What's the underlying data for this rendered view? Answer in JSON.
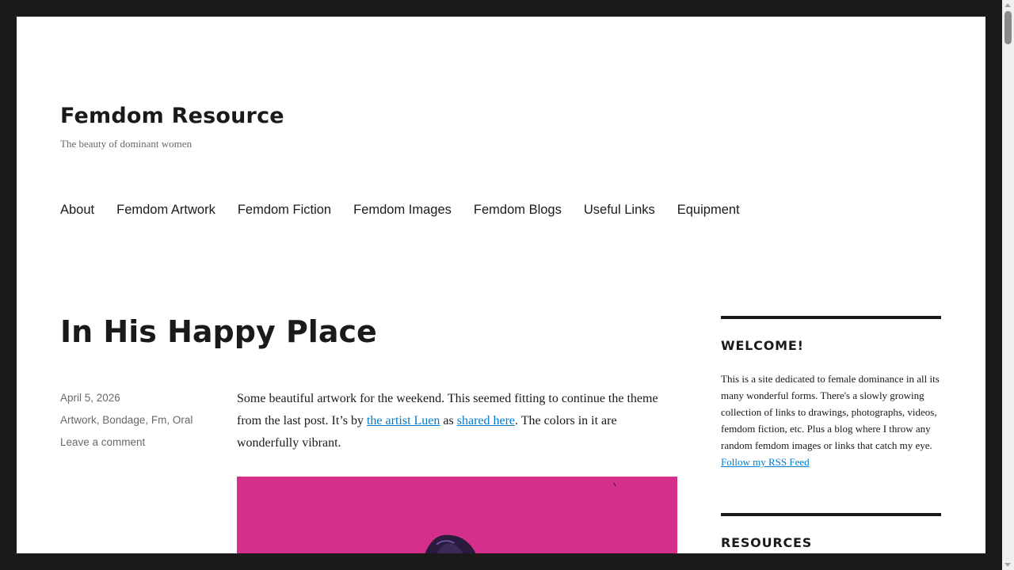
{
  "site": {
    "title": "Femdom Resource",
    "tagline": "The beauty of dominant women"
  },
  "nav": {
    "items": [
      {
        "label": "About"
      },
      {
        "label": "Femdom Artwork"
      },
      {
        "label": "Femdom Fiction"
      },
      {
        "label": "Femdom Images"
      },
      {
        "label": "Femdom Blogs"
      },
      {
        "label": "Useful Links"
      },
      {
        "label": "Equipment"
      }
    ]
  },
  "post": {
    "title": "In His Happy Place",
    "date": "April 5, 2026",
    "categories": [
      "Artwork",
      "Bondage",
      "Fm",
      "Oral"
    ],
    "comment_link": "Leave a comment",
    "content": {
      "text_1": "Some beautiful artwork for the weekend. This seemed fitting to continue the theme from the last post. It’s by ",
      "link_1": "the artist Luen",
      "text_2": " as ",
      "link_2": "shared here",
      "text_3": ". The colors in it are wonderfully vibrant."
    },
    "artwork_color": "#d42f8a"
  },
  "sidebar": {
    "welcome": {
      "title": "WELCOME!",
      "text": "This is a site dedicated to female dominance in all its many wonderful forms. There's a slowly growing collection of links to drawings, photographs, videos, femdom fiction, etc. Plus a blog where I throw any random femdom images or links that catch my eye.",
      "rss_link": "Follow my RSS Feed"
    },
    "resources": {
      "title": "RESOURCES"
    }
  },
  "colors": {
    "frame": "#1a1a1a",
    "page": "#ffffff",
    "text": "#1a1a1a",
    "muted": "#686868",
    "link": "#007acc"
  }
}
